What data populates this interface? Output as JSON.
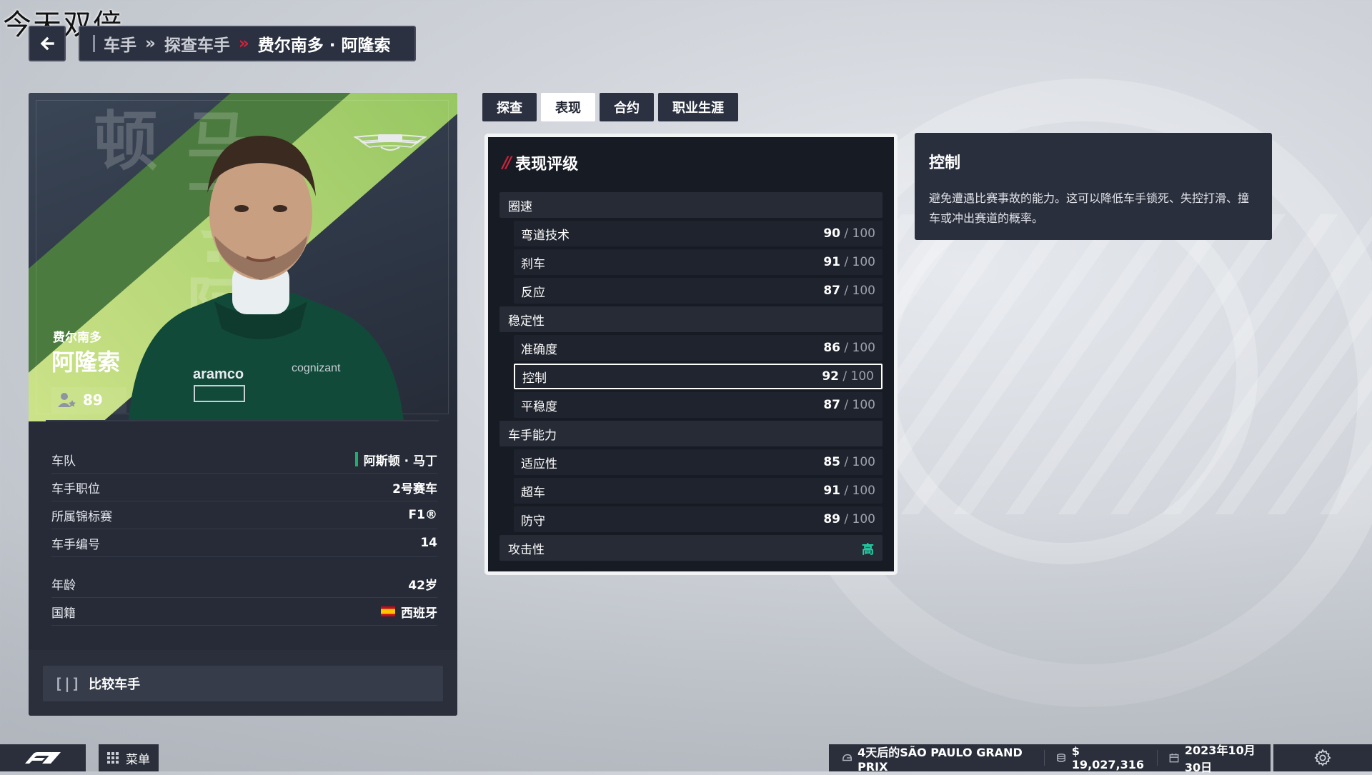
{
  "watermark": "今天双倍",
  "breadcrumb": {
    "items": [
      "车手",
      "探查车手"
    ],
    "current": "费尔南多 · 阿隆索",
    "separator": "»"
  },
  "driver": {
    "first_name": "费尔南多",
    "last_name": "阿隆索",
    "vertical_name": "马丁·阿斯顿",
    "rating": "89",
    "team_logo": "aston-martin-logo"
  },
  "info": {
    "team_label": "车队",
    "team_value": "阿斯顿 · 马丁",
    "role_label": "车手职位",
    "role_value": "2号赛车",
    "series_label": "所属锦标赛",
    "series_value": "F1®",
    "number_label": "车手编号",
    "number_value": "14",
    "age_label": "年龄",
    "age_value": "42岁",
    "nation_label": "国籍",
    "nation_value": "西班牙"
  },
  "compare": {
    "key": "[|]",
    "label": "比较车手"
  },
  "tabs": [
    "探查",
    "表现",
    "合约",
    "职业生涯"
  ],
  "active_tab": 1,
  "ratings": {
    "title": "表现评级",
    "max": "/ 100",
    "pace": {
      "label": "圈速",
      "items": [
        {
          "label": "弯道技术",
          "value": "90"
        },
        {
          "label": "刹车",
          "value": "91"
        },
        {
          "label": "反应",
          "value": "87"
        }
      ]
    },
    "consistency": {
      "label": "稳定性",
      "items": [
        {
          "label": "准确度",
          "value": "86"
        },
        {
          "label": "控制",
          "value": "92"
        },
        {
          "label": "平稳度",
          "value": "87"
        }
      ]
    },
    "racecraft": {
      "label": "车手能力",
      "items": [
        {
          "label": "适应性",
          "value": "85"
        },
        {
          "label": "超车",
          "value": "91"
        },
        {
          "label": "防守",
          "value": "89"
        }
      ]
    },
    "aggression_label": "攻击性",
    "aggression_value": "高"
  },
  "description": {
    "title": "控制",
    "body": "避免遭遇比赛事故的能力。这可以降低车手锁死、失控打滑、撞车或冲出赛道的概率。"
  },
  "bottom": {
    "menu_label": "菜单",
    "race_info": "4天后的SÃO PAULO GRAND PRIX",
    "budget": "$ 19,027,316",
    "date": "2023年10月30日"
  },
  "colors": {
    "accent_red": "#d0223a",
    "team_green": "#1db06b",
    "aggression_teal": "#23d3a8",
    "panel": "#171b24"
  }
}
